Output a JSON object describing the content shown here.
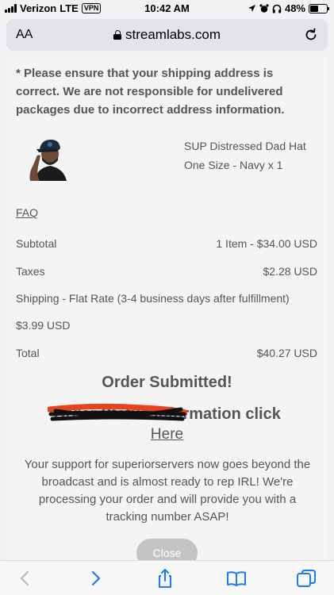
{
  "status_bar": {
    "carrier": "Verizon",
    "network": "LTE",
    "vpn": "VPN",
    "time": "10:42 AM",
    "battery": "48%",
    "battery_level": 0.48
  },
  "browser": {
    "text_size_label": "AA",
    "url": "streamlabs.com"
  },
  "page": {
    "shipping_notice": "* Please ensure that your shipping address is correct. We are not responsible for undelivered packages due to incorrect address information.",
    "product": {
      "name": "SUP Distressed Dad Hat",
      "variant": "One Size - Navy x 1"
    },
    "faq_link": "FAQ",
    "summary": {
      "subtotal_label": "Subtotal",
      "subtotal_value": "1 Item - $34.00 USD",
      "taxes_label": "Taxes",
      "taxes_value": "$2.28 USD",
      "shipping_label": "Shipping - Flat Rate (3-4 business days after fulfillment)",
      "shipping_value": "$3.99 USD",
      "total_label": "Total",
      "total_value": "$40.27 USD"
    },
    "order_submitted": "Order Submitted!",
    "order_info_line": "Order Status Information click",
    "here_link": "Here",
    "support_message": "Your support for superiorservers now goes beyond the broadcast and is almost ready to rep IRL! We're processing your order and will provide you with a tracking number ASAP!",
    "close_button": "Close"
  },
  "toolbar": {
    "icons": [
      "back-icon",
      "forward-icon",
      "share-icon",
      "bookmarks-icon",
      "tabs-icon"
    ],
    "accent": "#1a7cf4"
  }
}
